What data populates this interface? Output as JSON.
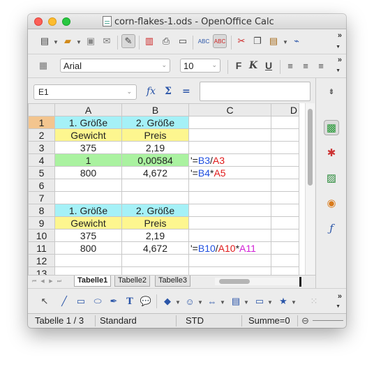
{
  "window": {
    "title": "corn-flakes-1.ods - OpenOffice Calc"
  },
  "formatting": {
    "font_name": "Arial",
    "font_size": "10",
    "bold_label": "F",
    "italic_label": "K",
    "underline_label": "U"
  },
  "formula_bar": {
    "name_box": "E1",
    "fx_label": "fx",
    "sum_label": "Σ",
    "equals_label": "=",
    "input_value": ""
  },
  "columns": [
    "A",
    "B",
    "C",
    "D"
  ],
  "rows": [
    {
      "num": "1",
      "a": "1. Größe",
      "b": "2. Größe",
      "c": ""
    },
    {
      "num": "2",
      "a": "Gewicht",
      "b": "Preis",
      "c": ""
    },
    {
      "num": "3",
      "a": "375",
      "b": "2,19",
      "c": ""
    },
    {
      "num": "4",
      "a": "1",
      "b": "0,00584",
      "c": ""
    },
    {
      "num": "5",
      "a": "800",
      "b": "4,672",
      "c": ""
    },
    {
      "num": "6",
      "a": "",
      "b": "",
      "c": ""
    },
    {
      "num": "7",
      "a": "",
      "b": "",
      "c": ""
    },
    {
      "num": "8",
      "a": "1. Größe",
      "b": "2. Größe",
      "c": ""
    },
    {
      "num": "9",
      "a": "Gewicht",
      "b": "Preis",
      "c": ""
    },
    {
      "num": "10",
      "a": "375",
      "b": "2,19",
      "c": ""
    },
    {
      "num": "11",
      "a": "800",
      "b": "4,672",
      "c": ""
    },
    {
      "num": "12",
      "a": "",
      "b": "",
      "c": ""
    },
    {
      "num": "13",
      "a": "",
      "b": "",
      "c": ""
    }
  ],
  "formulas": {
    "row4": {
      "prefix": "'=",
      "ref1": "B3",
      "op1": "/",
      "ref2": "A3"
    },
    "row5": {
      "prefix": "'=",
      "ref1": "B4",
      "op1": "*",
      "ref2": "A5"
    },
    "row11": {
      "prefix": "'=",
      "ref1": "B10",
      "op1": "/",
      "ref2": "A10",
      "op2": "*",
      "ref3": "A11"
    }
  },
  "sheets": [
    "Tabelle1",
    "Tabelle2",
    "Tabelle3"
  ],
  "status": {
    "sheet": "Tabelle 1 / 3",
    "style": "Standard",
    "mode": "STD",
    "sum": "Summe=0",
    "zoom_minus": "⊖"
  },
  "colors": {
    "header_cyan": "#a5f1f7",
    "label_yellow": "#fdf68f",
    "highlight_green": "#aaf2a0",
    "ref_blue": "#1f4fe0",
    "ref_red": "#e01a1a",
    "ref_magenta": "#d21fd6",
    "selected_row_header": "#f3c58f"
  }
}
